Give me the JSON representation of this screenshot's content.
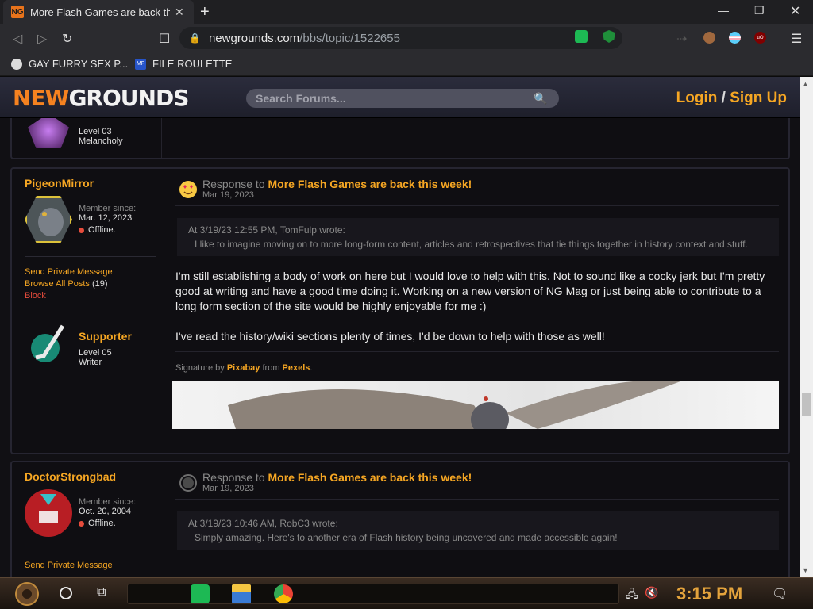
{
  "browser": {
    "tab_title": "More Flash Games are back this",
    "tab_favicon_text": "NG",
    "url_host": "newgrounds.com",
    "url_path": "/bbs/topic/1522655",
    "bookmarks": [
      {
        "label": "GAY FURRY SEX P..."
      },
      {
        "label": "FILE ROULETTE",
        "icon_text": "MF"
      }
    ]
  },
  "site": {
    "logo_part1": "NEW",
    "logo_part2": "GROUNDS",
    "search_placeholder": "Search Forums...",
    "login": "Login",
    "login_sep": "/",
    "signup": "Sign Up"
  },
  "prev_post": {
    "level": "Level 03",
    "rank": "Melancholy"
  },
  "posts": [
    {
      "username": "PigeonMirror",
      "member_since_label": "Member since:",
      "member_since": "Mar. 12, 2023",
      "status": "Offline.",
      "send_pm": "Send Private Message",
      "browse_posts": "Browse All Posts",
      "post_count": "(19)",
      "block": "Block",
      "badge_title": "Supporter",
      "badge_level": "Level 05",
      "badge_rank": "Writer",
      "response_prefix": "Response to",
      "thread_title": "More Flash Games are back this week!",
      "date": "Mar 19, 2023",
      "quote_header": "At 3/19/23 12:55 PM, TomFulp wrote:",
      "quote_body": "I like to imagine moving on to more long-form content, articles and retrospectives that tie things together in history context and stuff.",
      "body_p1": "I'm still establishing a body of work on here but I would love to help with this. Not to sound like a cocky jerk but I'm pretty good at writing and have a good time doing it. Working on a new version of NG Mag or just being able to contribute to a long form section of the site would be highly enjoyable for me :)",
      "body_p2": "I've read the history/wiki sections plenty of times, I'd be down to help with those as well!",
      "sig_prefix": "Signature by",
      "sig_author": "Pixabay",
      "sig_from": "from",
      "sig_source": "Pexels",
      "sig_end": "."
    },
    {
      "username": "DoctorStrongbad",
      "member_since_label": "Member since:",
      "member_since": "Oct. 20, 2004",
      "status": "Offline.",
      "send_pm": "Send Private Message",
      "response_prefix": "Response to",
      "thread_title": "More Flash Games are back this week!",
      "date": "Mar 19, 2023",
      "quote_header": "At 3/19/23 10:46 AM, RobC3 wrote:",
      "quote_body": "Simply amazing. Here's to another era of Flash history being uncovered and made accessible again!"
    }
  ],
  "taskbar": {
    "clock": "3:15 PM"
  },
  "colors": {
    "accent": "#f5a623",
    "brand_orange": "#f58220",
    "offline": "#e74c3c"
  }
}
